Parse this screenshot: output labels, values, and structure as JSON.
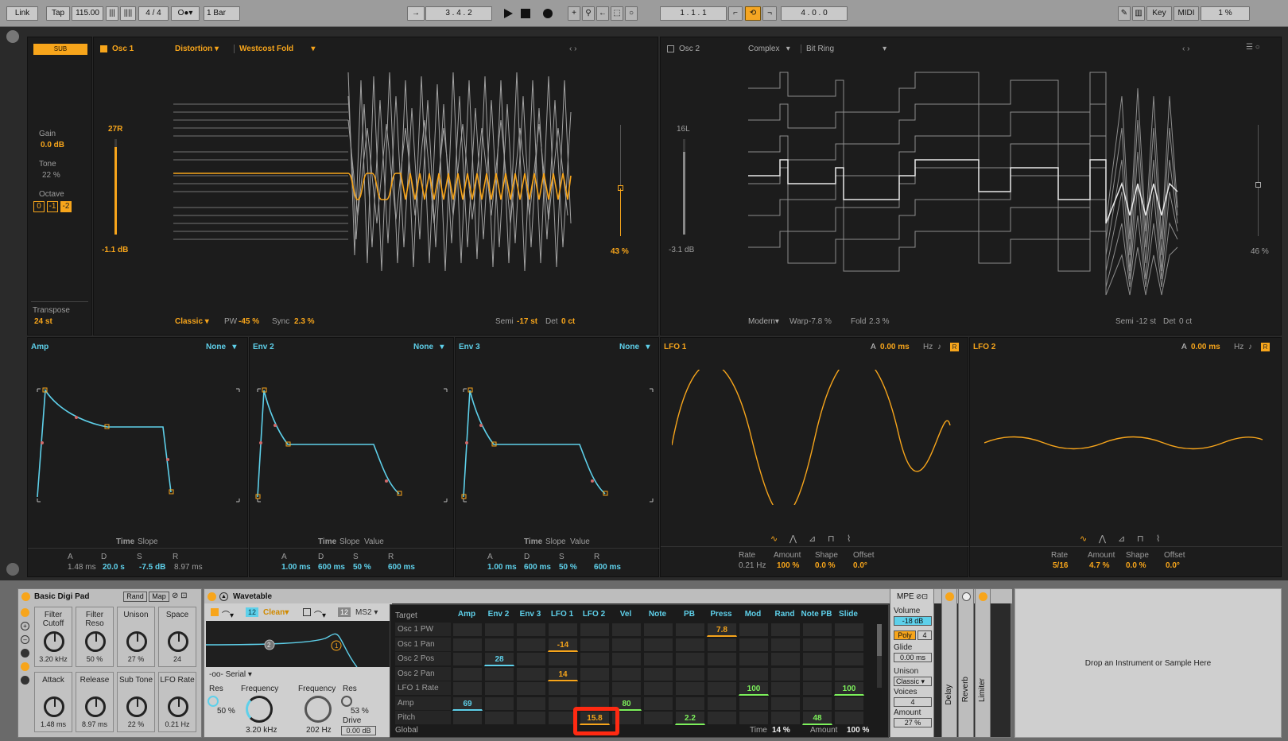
{
  "transport": {
    "link": "Link",
    "tap": "Tap",
    "tempo": "115.00",
    "sig": "4 / 4",
    "quant": "1 Bar",
    "pos": "3 . 4 . 2",
    "loop_start": "1 . 1 . 1",
    "loop_len": "4 . 0 . 0",
    "key": "Key",
    "midi": "MIDI",
    "cpu": "1 %"
  },
  "sub": {
    "badge": "SUB",
    "gain_label": "Gain",
    "gain": "0.0 dB",
    "tone_label": "Tone",
    "tone": "22 %",
    "octave_label": "Octave",
    "oct": [
      "0",
      "-1",
      "-2"
    ],
    "transpose_label": "Transpose",
    "transpose": "24 st"
  },
  "osc1": {
    "title": "Osc 1",
    "cat": "Distortion",
    "wave": "Westcost Fold",
    "level_top": "27R",
    "level": "-1.1 dB",
    "mode": "Classic",
    "pw_label": "PW",
    "pw": "-45 %",
    "sync_label": "Sync",
    "sync": "2.3 %",
    "semi_label": "Semi",
    "semi": "-17 st",
    "det_label": "Det",
    "det": "0 ct",
    "pos": "43 %"
  },
  "osc2": {
    "title": "Osc 2",
    "cat": "Complex",
    "wave": "Bit Ring",
    "level_top": "16L",
    "level": "-3.1 dB",
    "mode": "Modern",
    "warp_label": "Warp",
    "warp": "-7.8 %",
    "fold_label": "Fold",
    "fold": "2.3 %",
    "semi_label": "Semi",
    "semi": "-12 st",
    "det_label": "Det",
    "det": "0 ct",
    "pos": "46 %"
  },
  "env": [
    {
      "title": "Amp",
      "mode": "None",
      "tabs": [
        "Time",
        "Slope"
      ],
      "a": "1.48 ms",
      "d": "20.0 s",
      "s": "-7.5 dB",
      "r": "8.97 ms"
    },
    {
      "title": "Env 2",
      "mode": "None",
      "tabs": [
        "Time",
        "Slope",
        "Value"
      ],
      "a": "1.00 ms",
      "d": "600 ms",
      "s": "50 %",
      "r": "600 ms"
    },
    {
      "title": "Env 3",
      "mode": "None",
      "tabs": [
        "Time",
        "Slope",
        "Value"
      ],
      "a": "1.00 ms",
      "d": "600 ms",
      "s": "50 %",
      "r": "600 ms"
    }
  ],
  "adsr_labels": [
    "A",
    "D",
    "S",
    "R"
  ],
  "lfo": [
    {
      "title": "LFO 1",
      "a": "A",
      "a_val": "0.00 ms",
      "hz": "Hz",
      "rate": "0.21 Hz",
      "amount": "100 %",
      "shape": "0.0 %",
      "offset": "0.0°"
    },
    {
      "title": "LFO 2",
      "a": "A",
      "a_val": "0.00 ms",
      "hz": "Hz",
      "rate": "5/16",
      "amount": "4.7 %",
      "shape": "0.0 %",
      "offset": "0.0°"
    }
  ],
  "lfo_labels": {
    "rate": "Rate",
    "amount": "Amount",
    "shape": "Shape",
    "offset": "Offset"
  },
  "rack": {
    "title": "Basic Digi Pad",
    "rand": "Rand",
    "map": "Map",
    "macros": [
      {
        "t": "Filter Cutoff",
        "v": "3.20 kHz"
      },
      {
        "t": "Filter Reso",
        "v": "50 %"
      },
      {
        "t": "Unison",
        "v": "27 %"
      },
      {
        "t": "Space",
        "v": "24"
      },
      {
        "t": "Attack",
        "v": "1.48 ms"
      },
      {
        "t": "Release",
        "v": "8.97 ms"
      },
      {
        "t": "Sub Tone",
        "v": "22 %"
      },
      {
        "t": "LFO Rate",
        "v": "0.21 Hz"
      }
    ]
  },
  "wt": {
    "title": "Wavetable",
    "f1num": "12",
    "f1type": "Clean",
    "f2num": "12",
    "f2type": "MS2",
    "routing": "Serial",
    "res_label": "Res",
    "res": "50 %",
    "freq_label": "Frequency",
    "freq": "3.20 kHz",
    "freq2_label": "Frequency",
    "freq2": "202 Hz",
    "res2_label": "Res",
    "res2": "53 %",
    "drive_label": "Drive",
    "drive": "0.00 dB"
  },
  "matrix": {
    "target": "Target",
    "cols": [
      "Amp",
      "Env 2",
      "Env 3",
      "LFO 1",
      "LFO 2",
      "Vel",
      "Note",
      "PB",
      "Press",
      "Mod",
      "Rand",
      "Note PB",
      "Slide"
    ],
    "rows": [
      "Osc 1 PW",
      "Osc 1 Pan",
      "Osc 2 Pos",
      "Osc 2 Pan",
      "LFO 1 Rate",
      "Amp",
      "Pitch"
    ],
    "global": "Global",
    "time_label": "Time",
    "time": "14 %",
    "amount_label": "Amount",
    "amount": "100 %",
    "cells": [
      {
        "r": 0,
        "c": 8,
        "v": "7.8",
        "col": "orange"
      },
      {
        "r": 1,
        "c": 3,
        "v": "-14",
        "col": "orange"
      },
      {
        "r": 2,
        "c": 1,
        "v": "28",
        "col": "cyan"
      },
      {
        "r": 3,
        "c": 3,
        "v": "14",
        "col": "orange"
      },
      {
        "r": 4,
        "c": 9,
        "v": "100",
        "col": "green"
      },
      {
        "r": 4,
        "c": 12,
        "v": "100",
        "col": "green"
      },
      {
        "r": 5,
        "c": 0,
        "v": "69",
        "col": "cyan"
      },
      {
        "r": 5,
        "c": 5,
        "v": "80",
        "col": "green"
      },
      {
        "r": 6,
        "c": 4,
        "v": "15.8",
        "col": "orange"
      },
      {
        "r": 6,
        "c": 7,
        "v": "2.2",
        "col": "green"
      },
      {
        "r": 6,
        "c": 11,
        "v": "48",
        "col": "green"
      }
    ]
  },
  "mpe": {
    "label": "MPE",
    "volume_label": "Volume",
    "volume": "-18 dB",
    "poly": "Poly",
    "poly_n": "4",
    "glide_label": "Glide",
    "glide": "0.00 ms",
    "unison_label": "Unison",
    "unison": "Classic",
    "voices_label": "Voices",
    "voices": "4",
    "amount_label": "Amount",
    "amount": "27 %"
  },
  "fx": [
    "Delay",
    "Reverb",
    "Limiter"
  ],
  "drop": "Drop an Instrument or Sample Here",
  "colors": {
    "orange": "#f7a51b",
    "cyan": "#5ed0ea",
    "green": "#7cf05b",
    "highlight": "#ff2a12"
  }
}
